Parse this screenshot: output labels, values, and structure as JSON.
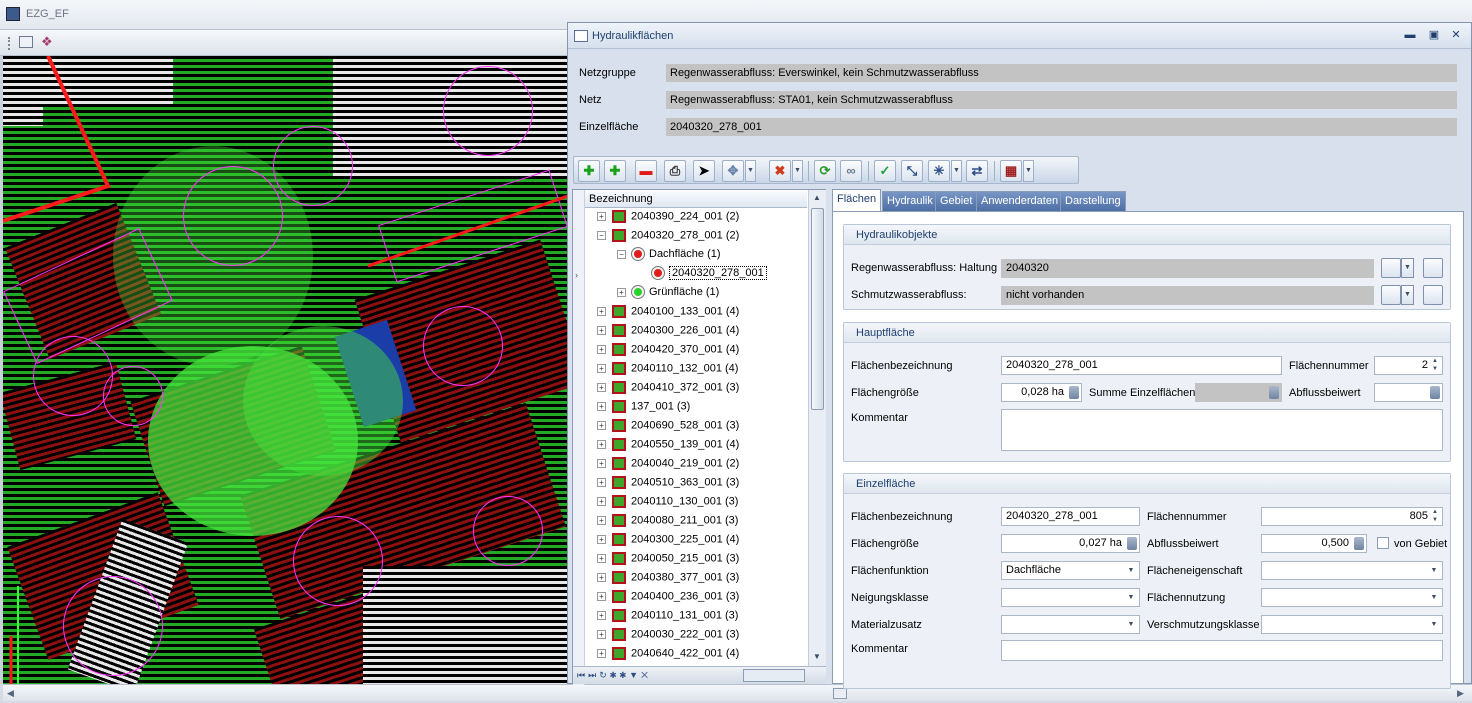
{
  "app": {
    "title": "EZG_EF"
  },
  "dialog": {
    "title": "Hydraulikflächen",
    "netzgruppe_label": "Netzgruppe",
    "netzgruppe_value": "Regenwasserabfluss: Everswinkel, kein Schmutzwasserabfluss",
    "netz_label": "Netz",
    "netz_value": "Regenwasserabfluss: STA01, kein Schmutzwasserabfluss",
    "einzelflaeche_label": "Einzelfläche",
    "einzelflaeche_value": "2040320_278_001"
  },
  "tree": {
    "column": "Bezeichnung",
    "nodes": [
      {
        "label": "2040390_224_001 (2)",
        "level": 0,
        "exp": "+",
        "icon": "area"
      },
      {
        "label": "2040320_278_001 (2)",
        "level": 0,
        "exp": "−",
        "icon": "area"
      },
      {
        "label": "Dachfläche (1)",
        "level": 1,
        "exp": "−",
        "icon": "red"
      },
      {
        "label": "2040320_278_001",
        "level": 2,
        "exp": "",
        "icon": "red",
        "selected": true
      },
      {
        "label": "Grünfläche (1)",
        "level": 1,
        "exp": "+",
        "icon": "green"
      },
      {
        "label": "2040100_133_001 (4)",
        "level": 0,
        "exp": "+",
        "icon": "area"
      },
      {
        "label": "2040300_226_001 (4)",
        "level": 0,
        "exp": "+",
        "icon": "area"
      },
      {
        "label": "2040420_370_001 (4)",
        "level": 0,
        "exp": "+",
        "icon": "area"
      },
      {
        "label": "2040110_132_001 (4)",
        "level": 0,
        "exp": "+",
        "icon": "area"
      },
      {
        "label": "2040410_372_001 (3)",
        "level": 0,
        "exp": "+",
        "icon": "area"
      },
      {
        "label": "137_001 (3)",
        "level": 0,
        "exp": "+",
        "icon": "area"
      },
      {
        "label": "2040690_528_001 (3)",
        "level": 0,
        "exp": "+",
        "icon": "area"
      },
      {
        "label": "2040550_139_001 (4)",
        "level": 0,
        "exp": "+",
        "icon": "area"
      },
      {
        "label": "2040040_219_001 (2)",
        "level": 0,
        "exp": "+",
        "icon": "area"
      },
      {
        "label": "2040510_363_001 (3)",
        "level": 0,
        "exp": "+",
        "icon": "area"
      },
      {
        "label": "2040110_130_001 (3)",
        "level": 0,
        "exp": "+",
        "icon": "area"
      },
      {
        "label": "2040080_211_001 (3)",
        "level": 0,
        "exp": "+",
        "icon": "area"
      },
      {
        "label": "2040300_225_001 (4)",
        "level": 0,
        "exp": "+",
        "icon": "area"
      },
      {
        "label": "2040050_215_001 (3)",
        "level": 0,
        "exp": "+",
        "icon": "area"
      },
      {
        "label": "2040380_377_001 (3)",
        "level": 0,
        "exp": "+",
        "icon": "area"
      },
      {
        "label": "2040400_236_001 (3)",
        "level": 0,
        "exp": "+",
        "icon": "area"
      },
      {
        "label": "2040110_131_001 (3)",
        "level": 0,
        "exp": "+",
        "icon": "area"
      },
      {
        "label": "2040030_222_001 (3)",
        "level": 0,
        "exp": "+",
        "icon": "area"
      },
      {
        "label": "2040640_422_001 (4)",
        "level": 0,
        "exp": "+",
        "icon": "area"
      }
    ]
  },
  "tabs": [
    "Flächen",
    "Hydraulik",
    "Gebiet",
    "Anwenderdaten",
    "Darstellung"
  ],
  "hydraulikobjekte": {
    "title": "Hydraulikobjekte",
    "regen_label": "Regenwasserabfluss: Haltung",
    "regen_value": "2040320",
    "schmutz_label": "Schmutzwasserabfluss:",
    "schmutz_value": "nicht vorhanden"
  },
  "hauptflaeche": {
    "title": "Hauptfläche",
    "bez_label": "Flächenbezeichnung",
    "bez_value": "2040320_278_001",
    "nr_label": "Flächennummer",
    "nr_value": "2",
    "groesse_label": "Flächengröße",
    "groesse_value": "0,028 ha",
    "summe_label": "Summe Einzelflächen",
    "summe_value": "",
    "abfluss_label": "Abflussbeiwert",
    "abfluss_value": "",
    "kommentar_label": "Kommentar",
    "kommentar_value": ""
  },
  "einzelflaeche": {
    "title": "Einzelfläche",
    "bez_label": "Flächenbezeichnung",
    "bez_value": "2040320_278_001",
    "nr_label": "Flächennummer",
    "nr_value": "805",
    "groesse_label": "Flächengröße",
    "groesse_value": "0,027 ha",
    "abfluss_label": "Abflussbeiwert",
    "abfluss_value": "0,500",
    "vongebiet_label": "von Gebiet",
    "funktion_label": "Flächenfunktion",
    "funktion_value": "Dachfläche",
    "eigenschaft_label": "Flächeneigenschaft",
    "eigenschaft_value": "",
    "neigung_label": "Neigungsklasse",
    "neigung_value": "",
    "nutzung_label": "Flächennutzung",
    "nutzung_value": "",
    "material_label": "Materialzusatz",
    "material_value": "",
    "verschm_label": "Verschmutzungsklasse",
    "verschm_value": "",
    "kommentar_label": "Kommentar",
    "kommentar_value": ""
  },
  "colors": {
    "accent": "#4d6fa6",
    "readonly": "#c3c3c3",
    "map_green": "#23a923",
    "map_red": "#8d1010",
    "map_line": "#ff33ff"
  }
}
